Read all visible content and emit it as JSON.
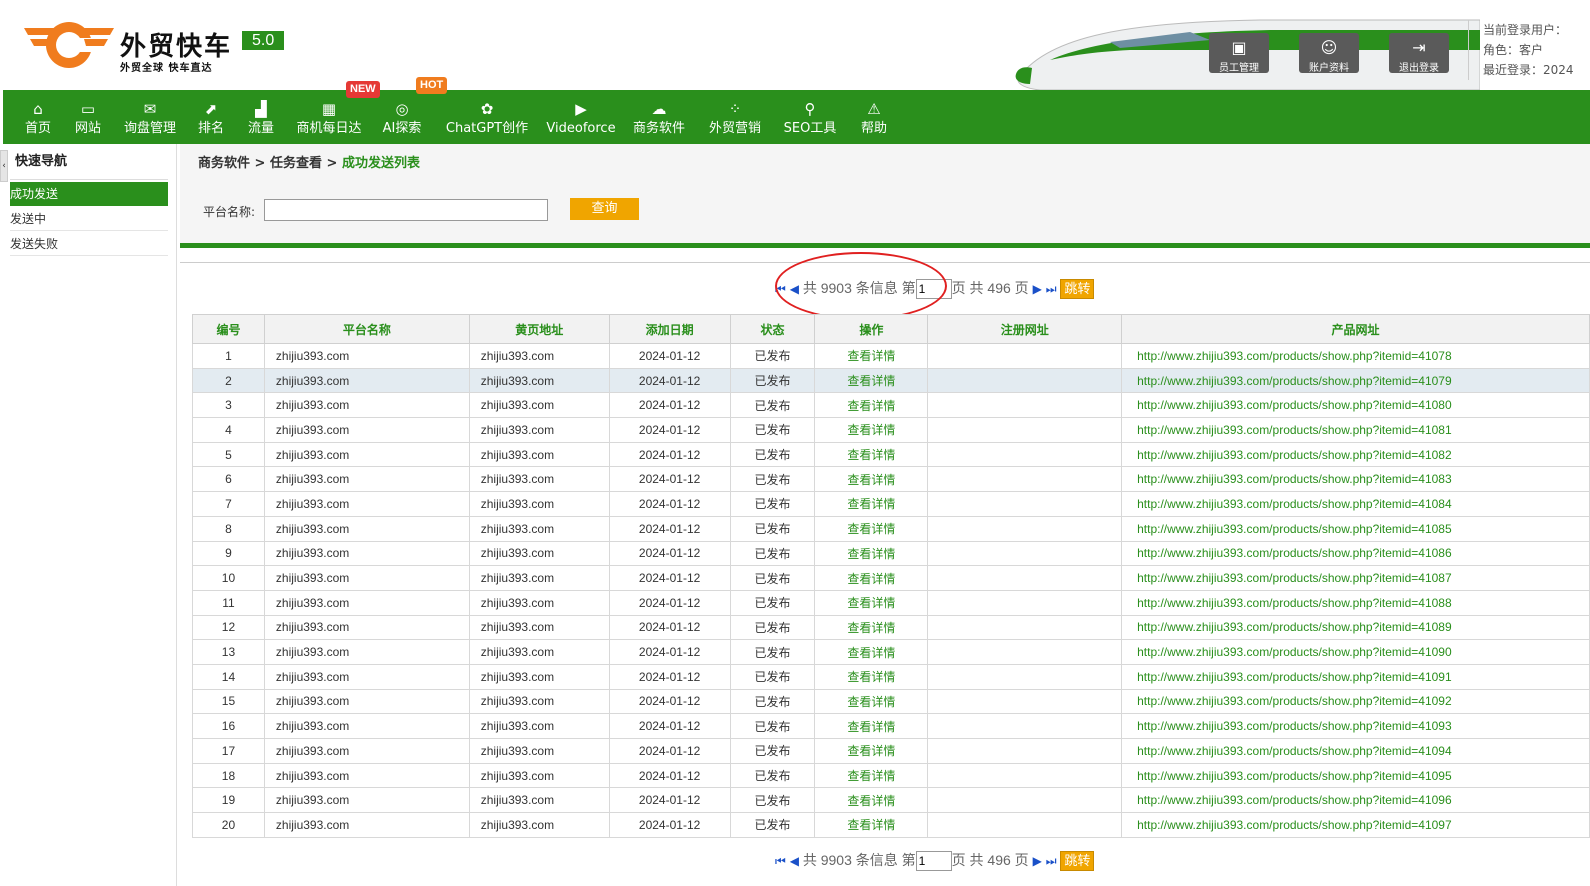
{
  "header": {
    "brand": "外贸快车",
    "version": "5.0",
    "slogan": "外贸全球 快车直达",
    "buttons": [
      {
        "label": "员工管理",
        "icon": "staff-icon"
      },
      {
        "label": "账户资料",
        "icon": "user-icon"
      },
      {
        "label": "退出登录",
        "icon": "logout-icon"
      }
    ],
    "user_info": {
      "current_user": "当前登录用户：",
      "role": "角色：客户",
      "last_login": "最近登录：2024"
    },
    "colors": {
      "brand_green": "#2a8f1c",
      "logo_orange": "#f07c1e"
    }
  },
  "nav": {
    "items": [
      {
        "label": "首页",
        "icon": "home-icon"
      },
      {
        "label": "网站",
        "icon": "monitor-icon"
      },
      {
        "label": "询盘管理",
        "icon": "mail-icon"
      },
      {
        "label": "排名",
        "icon": "ranking-icon"
      },
      {
        "label": "流量",
        "icon": "traffic-icon"
      },
      {
        "label": "商机每日达",
        "icon": "chart-icon"
      },
      {
        "label": "AI探索",
        "icon": "ai-icon"
      },
      {
        "label": "ChatGPT创作",
        "icon": "chatgpt-icon"
      },
      {
        "label": "Videoforce",
        "icon": "video-icon"
      },
      {
        "label": "商务软件",
        "icon": "cloud-icon"
      },
      {
        "label": "外贸营销",
        "icon": "apps-icon"
      },
      {
        "label": "SEO工具",
        "icon": "search-icon"
      },
      {
        "label": "帮助",
        "icon": "warning-icon"
      }
    ],
    "badge_new": "NEW",
    "badge_hot": "HOT"
  },
  "sidebar": {
    "title": "快速导航",
    "items": [
      "成功发送",
      "发送中",
      "发送失败"
    ],
    "active": "成功发送"
  },
  "breadcrumb": {
    "part1": "商务软件",
    "part2": "任务查看",
    "current": "成功发送列表",
    "sep": " > "
  },
  "search": {
    "label": "平台名称:",
    "value": "",
    "button": "查询"
  },
  "pagination": {
    "total_text": "共 9903 条信息 第",
    "page": "1",
    "pages_text": "页 共 496 页",
    "jump": "跳转"
  },
  "table": {
    "headers": [
      "编号",
      "平台名称",
      "黄页地址",
      "添加日期",
      "状态",
      "操作",
      "注册网址",
      "产品网址"
    ],
    "action_label": "查看详情",
    "rows": [
      {
        "id": "1",
        "platform": "zhijiu393.com",
        "yellow": "zhijiu393.com",
        "date": "2024-01-12",
        "status": "已发布",
        "reg": "",
        "url": "http://www.zhijiu393.com/products/show.php?itemid=41078"
      },
      {
        "id": "2",
        "platform": "zhijiu393.com",
        "yellow": "zhijiu393.com",
        "date": "2024-01-12",
        "status": "已发布",
        "reg": "",
        "url": "http://www.zhijiu393.com/products/show.php?itemid=41079"
      },
      {
        "id": "3",
        "platform": "zhijiu393.com",
        "yellow": "zhijiu393.com",
        "date": "2024-01-12",
        "status": "已发布",
        "reg": "",
        "url": "http://www.zhijiu393.com/products/show.php?itemid=41080"
      },
      {
        "id": "4",
        "platform": "zhijiu393.com",
        "yellow": "zhijiu393.com",
        "date": "2024-01-12",
        "status": "已发布",
        "reg": "",
        "url": "http://www.zhijiu393.com/products/show.php?itemid=41081"
      },
      {
        "id": "5",
        "platform": "zhijiu393.com",
        "yellow": "zhijiu393.com",
        "date": "2024-01-12",
        "status": "已发布",
        "reg": "",
        "url": "http://www.zhijiu393.com/products/show.php?itemid=41082"
      },
      {
        "id": "6",
        "platform": "zhijiu393.com",
        "yellow": "zhijiu393.com",
        "date": "2024-01-12",
        "status": "已发布",
        "reg": "",
        "url": "http://www.zhijiu393.com/products/show.php?itemid=41083"
      },
      {
        "id": "7",
        "platform": "zhijiu393.com",
        "yellow": "zhijiu393.com",
        "date": "2024-01-12",
        "status": "已发布",
        "reg": "",
        "url": "http://www.zhijiu393.com/products/show.php?itemid=41084"
      },
      {
        "id": "8",
        "platform": "zhijiu393.com",
        "yellow": "zhijiu393.com",
        "date": "2024-01-12",
        "status": "已发布",
        "reg": "",
        "url": "http://www.zhijiu393.com/products/show.php?itemid=41085"
      },
      {
        "id": "9",
        "platform": "zhijiu393.com",
        "yellow": "zhijiu393.com",
        "date": "2024-01-12",
        "status": "已发布",
        "reg": "",
        "url": "http://www.zhijiu393.com/products/show.php?itemid=41086"
      },
      {
        "id": "10",
        "platform": "zhijiu393.com",
        "yellow": "zhijiu393.com",
        "date": "2024-01-12",
        "status": "已发布",
        "reg": "",
        "url": "http://www.zhijiu393.com/products/show.php?itemid=41087"
      },
      {
        "id": "11",
        "platform": "zhijiu393.com",
        "yellow": "zhijiu393.com",
        "date": "2024-01-12",
        "status": "已发布",
        "reg": "",
        "url": "http://www.zhijiu393.com/products/show.php?itemid=41088"
      },
      {
        "id": "12",
        "platform": "zhijiu393.com",
        "yellow": "zhijiu393.com",
        "date": "2024-01-12",
        "status": "已发布",
        "reg": "",
        "url": "http://www.zhijiu393.com/products/show.php?itemid=41089"
      },
      {
        "id": "13",
        "platform": "zhijiu393.com",
        "yellow": "zhijiu393.com",
        "date": "2024-01-12",
        "status": "已发布",
        "reg": "",
        "url": "http://www.zhijiu393.com/products/show.php?itemid=41090"
      },
      {
        "id": "14",
        "platform": "zhijiu393.com",
        "yellow": "zhijiu393.com",
        "date": "2024-01-12",
        "status": "已发布",
        "reg": "",
        "url": "http://www.zhijiu393.com/products/show.php?itemid=41091"
      },
      {
        "id": "15",
        "platform": "zhijiu393.com",
        "yellow": "zhijiu393.com",
        "date": "2024-01-12",
        "status": "已发布",
        "reg": "",
        "url": "http://www.zhijiu393.com/products/show.php?itemid=41092"
      },
      {
        "id": "16",
        "platform": "zhijiu393.com",
        "yellow": "zhijiu393.com",
        "date": "2024-01-12",
        "status": "已发布",
        "reg": "",
        "url": "http://www.zhijiu393.com/products/show.php?itemid=41093"
      },
      {
        "id": "17",
        "platform": "zhijiu393.com",
        "yellow": "zhijiu393.com",
        "date": "2024-01-12",
        "status": "已发布",
        "reg": "",
        "url": "http://www.zhijiu393.com/products/show.php?itemid=41094"
      },
      {
        "id": "18",
        "platform": "zhijiu393.com",
        "yellow": "zhijiu393.com",
        "date": "2024-01-12",
        "status": "已发布",
        "reg": "",
        "url": "http://www.zhijiu393.com/products/show.php?itemid=41095"
      },
      {
        "id": "19",
        "platform": "zhijiu393.com",
        "yellow": "zhijiu393.com",
        "date": "2024-01-12",
        "status": "已发布",
        "reg": "",
        "url": "http://www.zhijiu393.com/products/show.php?itemid=41096"
      },
      {
        "id": "20",
        "platform": "zhijiu393.com",
        "yellow": "zhijiu393.com",
        "date": "2024-01-12",
        "status": "已发布",
        "reg": "",
        "url": "http://www.zhijiu393.com/products/show.php?itemid=41097"
      }
    ],
    "highlighted_row": 2
  }
}
